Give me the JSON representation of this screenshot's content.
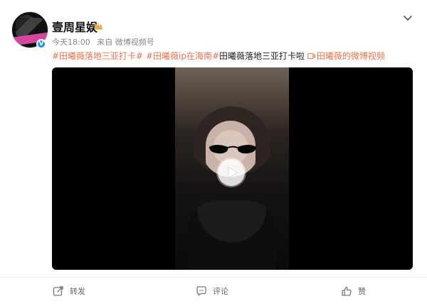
{
  "post": {
    "username": "壹周星娱",
    "time": "今天18:00",
    "source": "来自 微博视频号",
    "content": {
      "hashtag1": "#田曦薇落地三亚打卡#",
      "hashtag2": "#田曦薇ip在海南#",
      "text": "田曦薇落地三亚打卡啦",
      "video_link": "田曦薇的微博视频"
    }
  },
  "actions": {
    "repost": "转发",
    "comment": "评论",
    "like": "赞"
  },
  "colors": {
    "tag": "#eb7350",
    "verified": "#1f8ff2",
    "muted": "#888888"
  },
  "icons": {
    "verified": "verified-badge",
    "crown": "crown-icon",
    "menu": "chevron-down-icon",
    "video": "video-icon",
    "play": "play-icon",
    "repost": "repost-icon",
    "comment": "comment-icon",
    "like": "like-icon"
  }
}
